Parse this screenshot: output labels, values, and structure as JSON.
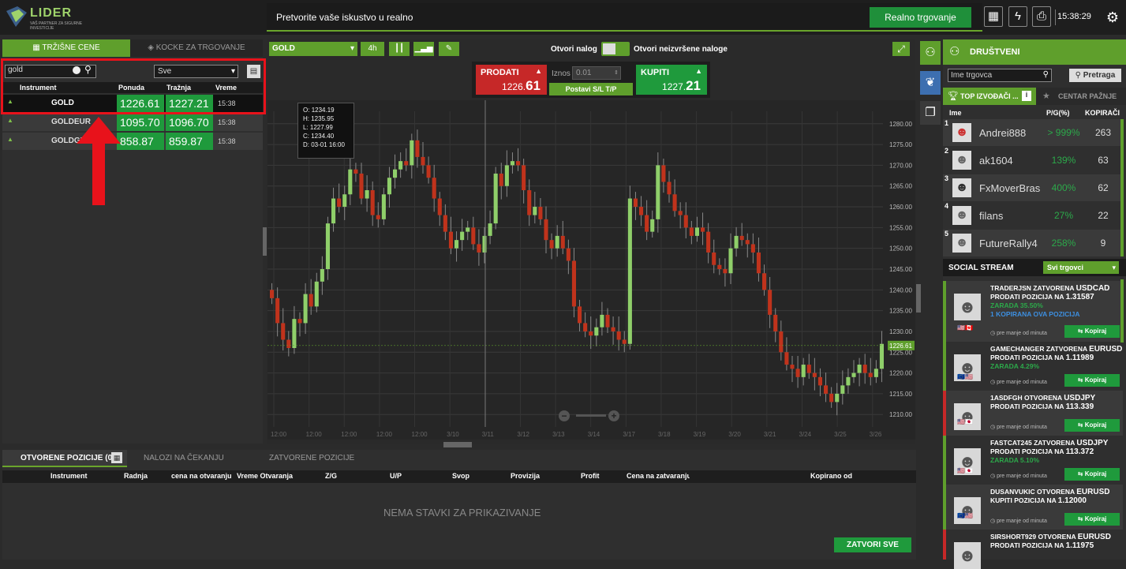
{
  "header": {
    "logo_text": "LIDER",
    "logo_sub": "VAŠ PARTNER ZA SIGURNE INVESTICIJE",
    "banner_text": "Pretvorite vaše iskustvo u realno",
    "real_button": "Realno trgovanje",
    "clock": "15:38:29"
  },
  "left": {
    "tab_prices": "TRŽIŠNE CENE",
    "tab_cubes": "KOCKE ZA TRGOVANJE",
    "search_value": "gold",
    "filter_value": "Sve",
    "columns": [
      "Instrument",
      "Ponuda",
      "Tražnja",
      "Vreme"
    ],
    "rows": [
      {
        "name": "GOLD",
        "bid": "1226.61",
        "ask": "1227.21",
        "time": "15:38"
      },
      {
        "name": "GOLDEUR",
        "bid": "1095.70",
        "ask": "1096.70",
        "time": "15:38"
      },
      {
        "name": "GOLDGBP",
        "bid": "858.87",
        "ask": "859.87",
        "time": "15:38"
      }
    ]
  },
  "chart": {
    "symbol": "GOLD",
    "timeframe": "4h",
    "open_order": "Otvori nalog",
    "pending_orders": "Otvori neizvršene naloge",
    "sell_label": "PRODATI",
    "sell_price_small": "1226.",
    "sell_price_big": "61",
    "buy_label": "KUPITI",
    "buy_price_small": "1227.",
    "buy_price_big": "21",
    "amount_label": "Iznos",
    "amount_value": "0.01",
    "sltp_button": "Postavi S/L T/P",
    "ohlc": [
      "O:",
      "1234.19",
      "H:",
      "1235.95",
      "L:",
      "1227.99",
      "C:",
      "1234.40",
      "D:",
      "03-01 16:00"
    ],
    "price_tag": "1226.61"
  },
  "chart_data": {
    "type": "candlestick",
    "y_ticks": [
      "1280.00",
      "1275.00",
      "1270.00",
      "1265.00",
      "1260.00",
      "1255.00",
      "1250.00",
      "1245.00",
      "1240.00",
      "1235.00",
      "1230.00",
      "1225.00",
      "1220.00",
      "1215.00",
      "1210.00"
    ],
    "ylim": [
      1207,
      1283
    ],
    "x_ticks": [
      "12:00",
      "12:00",
      "12:00",
      "12:00",
      "12:00",
      "3/10",
      "3/11",
      "3/12",
      "3/13",
      "3/14",
      "3/17",
      "3/18",
      "3/19",
      "3/20",
      "3/21",
      "3/24",
      "3/25",
      "3/26"
    ],
    "closes": [
      1238,
      1232,
      1228,
      1226,
      1233,
      1232,
      1239,
      1236,
      1242,
      1245,
      1256,
      1262,
      1260,
      1263,
      1269,
      1268,
      1262,
      1264,
      1258,
      1257,
      1263,
      1267,
      1269,
      1271,
      1270,
      1276,
      1272,
      1270,
      1267,
      1262,
      1258,
      1254,
      1250,
      1252,
      1254,
      1255,
      1251,
      1249,
      1253,
      1256,
      1268,
      1265,
      1270,
      1271,
      1270,
      1264,
      1258,
      1260,
      1257,
      1252,
      1250,
      1253,
      1250,
      1247,
      1236,
      1232,
      1230,
      1229,
      1231,
      1234,
      1231,
      1230,
      1228,
      1227,
      1262,
      1260,
      1258,
      1254,
      1257,
      1270,
      1266,
      1263,
      1259,
      1258,
      1255,
      1253,
      1255,
      1254,
      1249,
      1246,
      1245,
      1244,
      1250,
      1253,
      1252,
      1251,
      1249,
      1244,
      1240,
      1234,
      1230,
      1225,
      1222,
      1221,
      1219,
      1222,
      1220,
      1219,
      1217,
      1215,
      1213,
      1215,
      1217,
      1219,
      1220,
      1222,
      1220,
      1219,
      1221,
      1227
    ],
    "grid": true
  },
  "bottom": {
    "tab_open": "OTVORENE POZICIJE (0)",
    "tab_pending": "NALOZI NA ČEKANJU",
    "tab_closed": "ZATVORENE POZICIJE",
    "columns": [
      "Instrument",
      "Radnja",
      "cena na otvaranju",
      "Vreme Otvaranja",
      "Z/G",
      "U/P",
      "Svop",
      "Provizija",
      "Profit",
      "Cena na zatvaranju",
      "Kopirano od"
    ],
    "empty": "NEMA STAVKI ZA PRIKAZIVANJE",
    "close_all": "ZATVORI SVE"
  },
  "right": {
    "title": "DRUŠTVENI",
    "search_placeholder": "Ime trgovca",
    "search_button": "Pretraga",
    "tab_top": "TOP IZVOĐAČI ...",
    "tab_center": "CENTAR PAŽNJE",
    "columns": [
      "Ime",
      "P/G(%)",
      "KOPIRAČI"
    ],
    "traders": [
      {
        "rank": "1",
        "name": "Andrei888",
        "pct": "> 999%",
        "copiers": "263"
      },
      {
        "rank": "2",
        "name": "ak1604",
        "pct": "139%",
        "copiers": "63"
      },
      {
        "rank": "3",
        "name": "FxMoverBras",
        "pct": "400%",
        "copiers": "62"
      },
      {
        "rank": "4",
        "name": "filans",
        "pct": "27%",
        "copiers": "22"
      },
      {
        "rank": "5",
        "name": "FutureRally4",
        "pct": "258%",
        "copiers": "9"
      }
    ],
    "stream_title": "SOCIAL STREAM",
    "stream_filter": "Svi trgovci",
    "copy_label": "Kopiraj",
    "time_label": "pre manje od minuta",
    "stream": [
      {
        "l1a": "TRADERJSN ZATVORENA ",
        "l1b": "USDCAD",
        "l2a": "PRODATI POZICIJA NA ",
        "l2b": "1.31587",
        "gain": "ZARADA 35.50%",
        "extra": "1 KOPIRANA OVA POZICIJA"
      },
      {
        "l1a": "GAMECHANGER ZATVORENA ",
        "l1b": "EURUSD",
        "l2a": "PRODATI POZICIJA NA ",
        "l2b": "1.11989",
        "gain": "ZARADA 4.29%",
        "extra": ""
      },
      {
        "l1a": "1ASDFGH OTVORENA ",
        "l1b": "USDJPY",
        "l2a": "PRODATI POZICIJA NA ",
        "l2b": "113.339",
        "gain": "",
        "extra": ""
      },
      {
        "l1a": "FASTCAT245 ZATVORENA ",
        "l1b": "USDJPY",
        "l2a": "PRODATI POZICIJA NA ",
        "l2b": "113.372",
        "gain": "ZARADA 5.10%",
        "extra": ""
      },
      {
        "l1a": "DUSANVUKIC OTVORENA ",
        "l1b": "EURUSD",
        "l2a": "KUPITI POZICIJA NA ",
        "l2b": "1.12000",
        "gain": "",
        "extra": ""
      },
      {
        "l1a": "SIRSHORT929 OTVORENA ",
        "l1b": "EURUSD",
        "l2a": "PRODATI POZICIJA NA ",
        "l2b": "1.11975",
        "gain": "",
        "extra": ""
      }
    ]
  }
}
